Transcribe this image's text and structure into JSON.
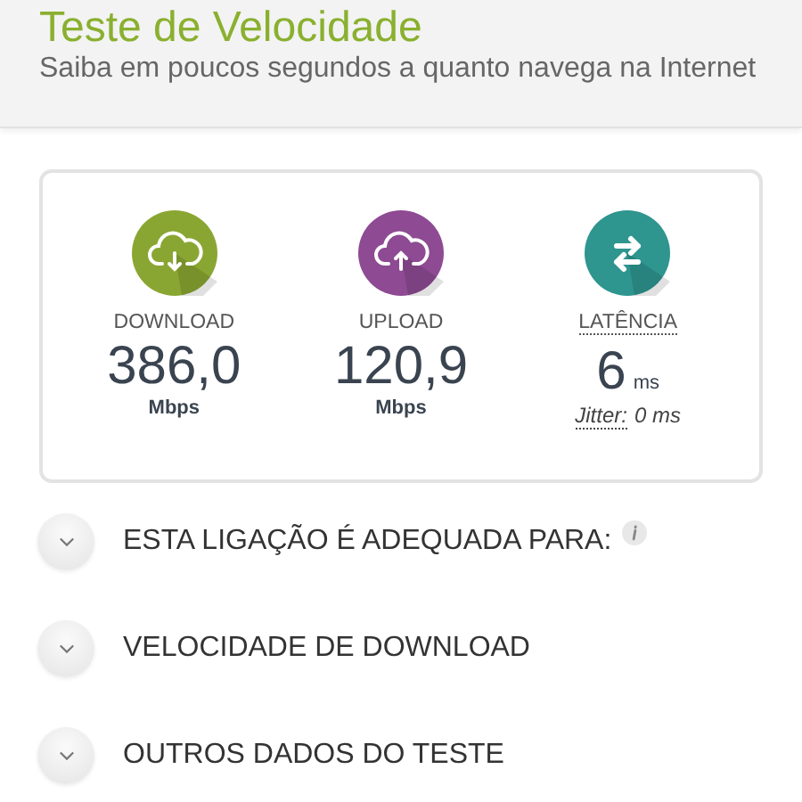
{
  "header": {
    "title": "Teste de Velocidade",
    "subtitle": "Saiba em poucos segundos a quanto navega na Internet"
  },
  "metrics": [
    {
      "kind": "download",
      "label": "DOWNLOAD",
      "value": "386,0",
      "unit": "Mbps"
    },
    {
      "kind": "upload",
      "label": "UPLOAD",
      "value": "120,9",
      "unit": "Mbps"
    },
    {
      "kind": "latency",
      "label": "LATÊNCIA",
      "value": "6",
      "unit": "ms",
      "jitter_label": "Jitter:",
      "jitter_value": "0 ms"
    }
  ],
  "sections": [
    {
      "label": "ESTA LIGAÇÃO É ADEQUADA PARA:",
      "expanded": false,
      "info": true
    },
    {
      "label": "VELOCIDADE DE DOWNLOAD",
      "expanded": false,
      "info": false
    },
    {
      "label": "OUTROS DADOS DO TESTE",
      "expanded": false,
      "info": false
    }
  ]
}
